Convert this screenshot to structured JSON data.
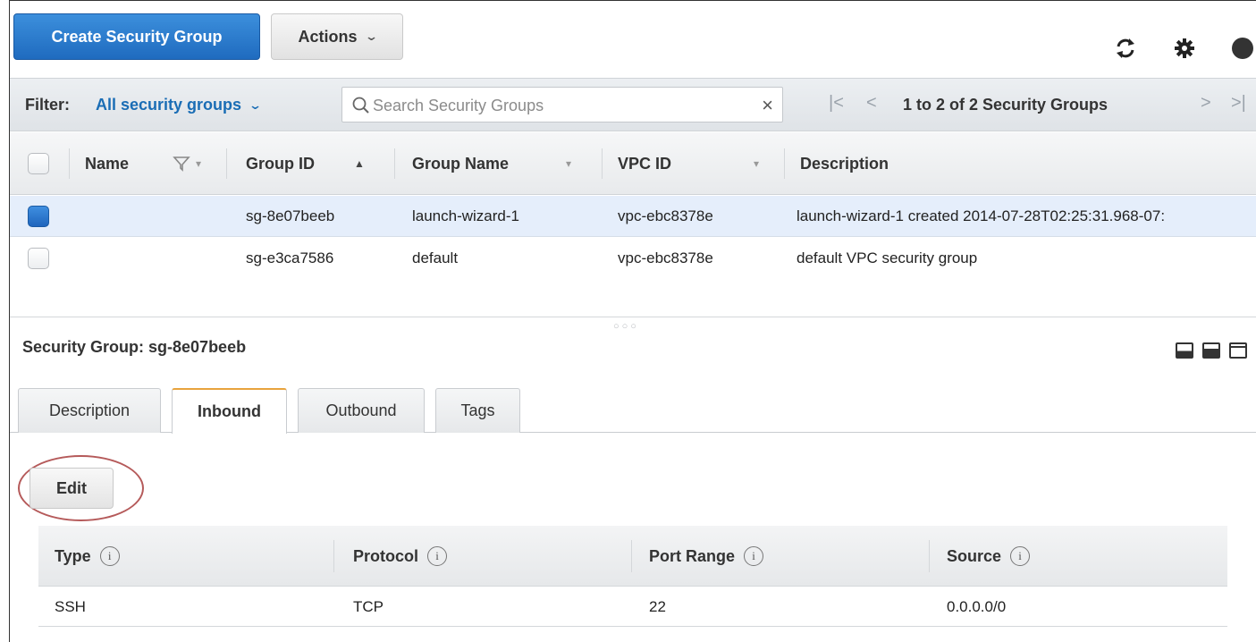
{
  "toolbar": {
    "create_label": "Create Security Group",
    "actions_label": "Actions"
  },
  "filter": {
    "label": "Filter:",
    "value": "All security groups",
    "search_placeholder": "Search Security Groups",
    "pager_text": "1 to 2 of 2 Security Groups"
  },
  "grid": {
    "columns": [
      "Name",
      "Group ID",
      "Group Name",
      "VPC ID",
      "Description"
    ],
    "rows": [
      {
        "selected": true,
        "name": "",
        "group_id": "sg-8e07beeb",
        "group_name": "launch-wizard-1",
        "vpc_id": "vpc-ebc8378e",
        "description": "launch-wizard-1 created 2014-07-28T02:25:31.968-07:"
      },
      {
        "selected": false,
        "name": "",
        "group_id": "sg-e3ca7586",
        "group_name": "default",
        "vpc_id": "vpc-ebc8378e",
        "description": "default VPC security group"
      }
    ]
  },
  "detail": {
    "title": "Security Group: sg-8e07beeb",
    "tabs": [
      "Description",
      "Inbound",
      "Outbound",
      "Tags"
    ],
    "active_tab": "Inbound",
    "edit_label": "Edit",
    "rules_columns": [
      "Type",
      "Protocol",
      "Port Range",
      "Source"
    ],
    "rules": [
      {
        "type": "SSH",
        "protocol": "TCP",
        "port_range": "22",
        "source": "0.0.0.0/0"
      }
    ],
    "info_glyph": "i"
  },
  "colors": {
    "primary": "#1f6bbf",
    "link": "#1a6db5",
    "active_tab_accent": "#e8a33d",
    "annotation_circle": "#b55a5a"
  }
}
